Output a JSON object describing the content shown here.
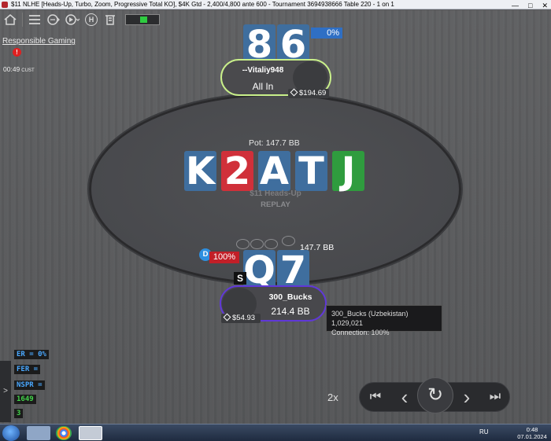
{
  "window": {
    "title": "$11 NLHE [Heads-Up, Turbo, Zoom, Progressive Total KO], $4K Gtd - 2,400/4,800 ante 600 - Tournament 3694938666 Table 220 - 1 on 1",
    "controls": [
      "—",
      "□",
      "✕"
    ]
  },
  "toolbar": {
    "icons": [
      "home-icon",
      "menu-icon",
      "chat-icon",
      "play-icon",
      "hotkey-icon",
      "cashier-icon"
    ],
    "hotkey_letter": "H",
    "progress_fraction": 0.4
  },
  "responsible_gaming": "Responsible Gaming",
  "alert_symbol": "!",
  "timer": {
    "time": "00:49",
    "label": "CUST"
  },
  "top_player": {
    "cards": [
      {
        "rank": "8",
        "color": "blue"
      },
      {
        "rank": "6",
        "color": "blue"
      }
    ],
    "equity": "0%",
    "name": "--Vitaliy948",
    "status": "All In",
    "stack": "$194.69"
  },
  "pot": "Pot: 147.7 BB",
  "board": [
    {
      "rank": "K",
      "color": "blue"
    },
    {
      "rank": "2",
      "color": "red"
    },
    {
      "rank": "A",
      "color": "blue"
    },
    {
      "rank": "T",
      "color": "blue"
    },
    {
      "rank": "J",
      "color": "green"
    }
  ],
  "table_name": "$11 Heads-Up",
  "replay_label": "REPLAY",
  "bottom_player": {
    "bet": "147.7 BB",
    "dealer": "D",
    "equity": "100%",
    "cards": [
      {
        "rank": "Q",
        "color": "blue"
      },
      {
        "rank": "7",
        "color": "blue"
      }
    ],
    "badge": "S",
    "name": "300_Bucks",
    "stack_bb": "214.4 BB",
    "stack": "$54.93"
  },
  "tooltip": {
    "line1": "300_Bucks (Uzbekistan) 1,029,021",
    "line2": "Connection: 100%"
  },
  "hud": {
    "tab": ">",
    "stats": [
      {
        "text": "ER = 0%",
        "color": "blue"
      },
      {
        "text": "FER = ",
        "color": "blue"
      },
      {
        "text": "NSPR = ",
        "color": "blue"
      },
      {
        "text": "1649",
        "color": "green"
      },
      {
        "text": "3",
        "color": "green"
      }
    ]
  },
  "replay_controls": {
    "speed": "2x",
    "first": "⏮",
    "prev": "‹",
    "replay": "↻",
    "next": "›",
    "last": "⏭"
  },
  "taskbar": {
    "lang": "RU",
    "time": "0:48",
    "date": "07.01.2024"
  }
}
